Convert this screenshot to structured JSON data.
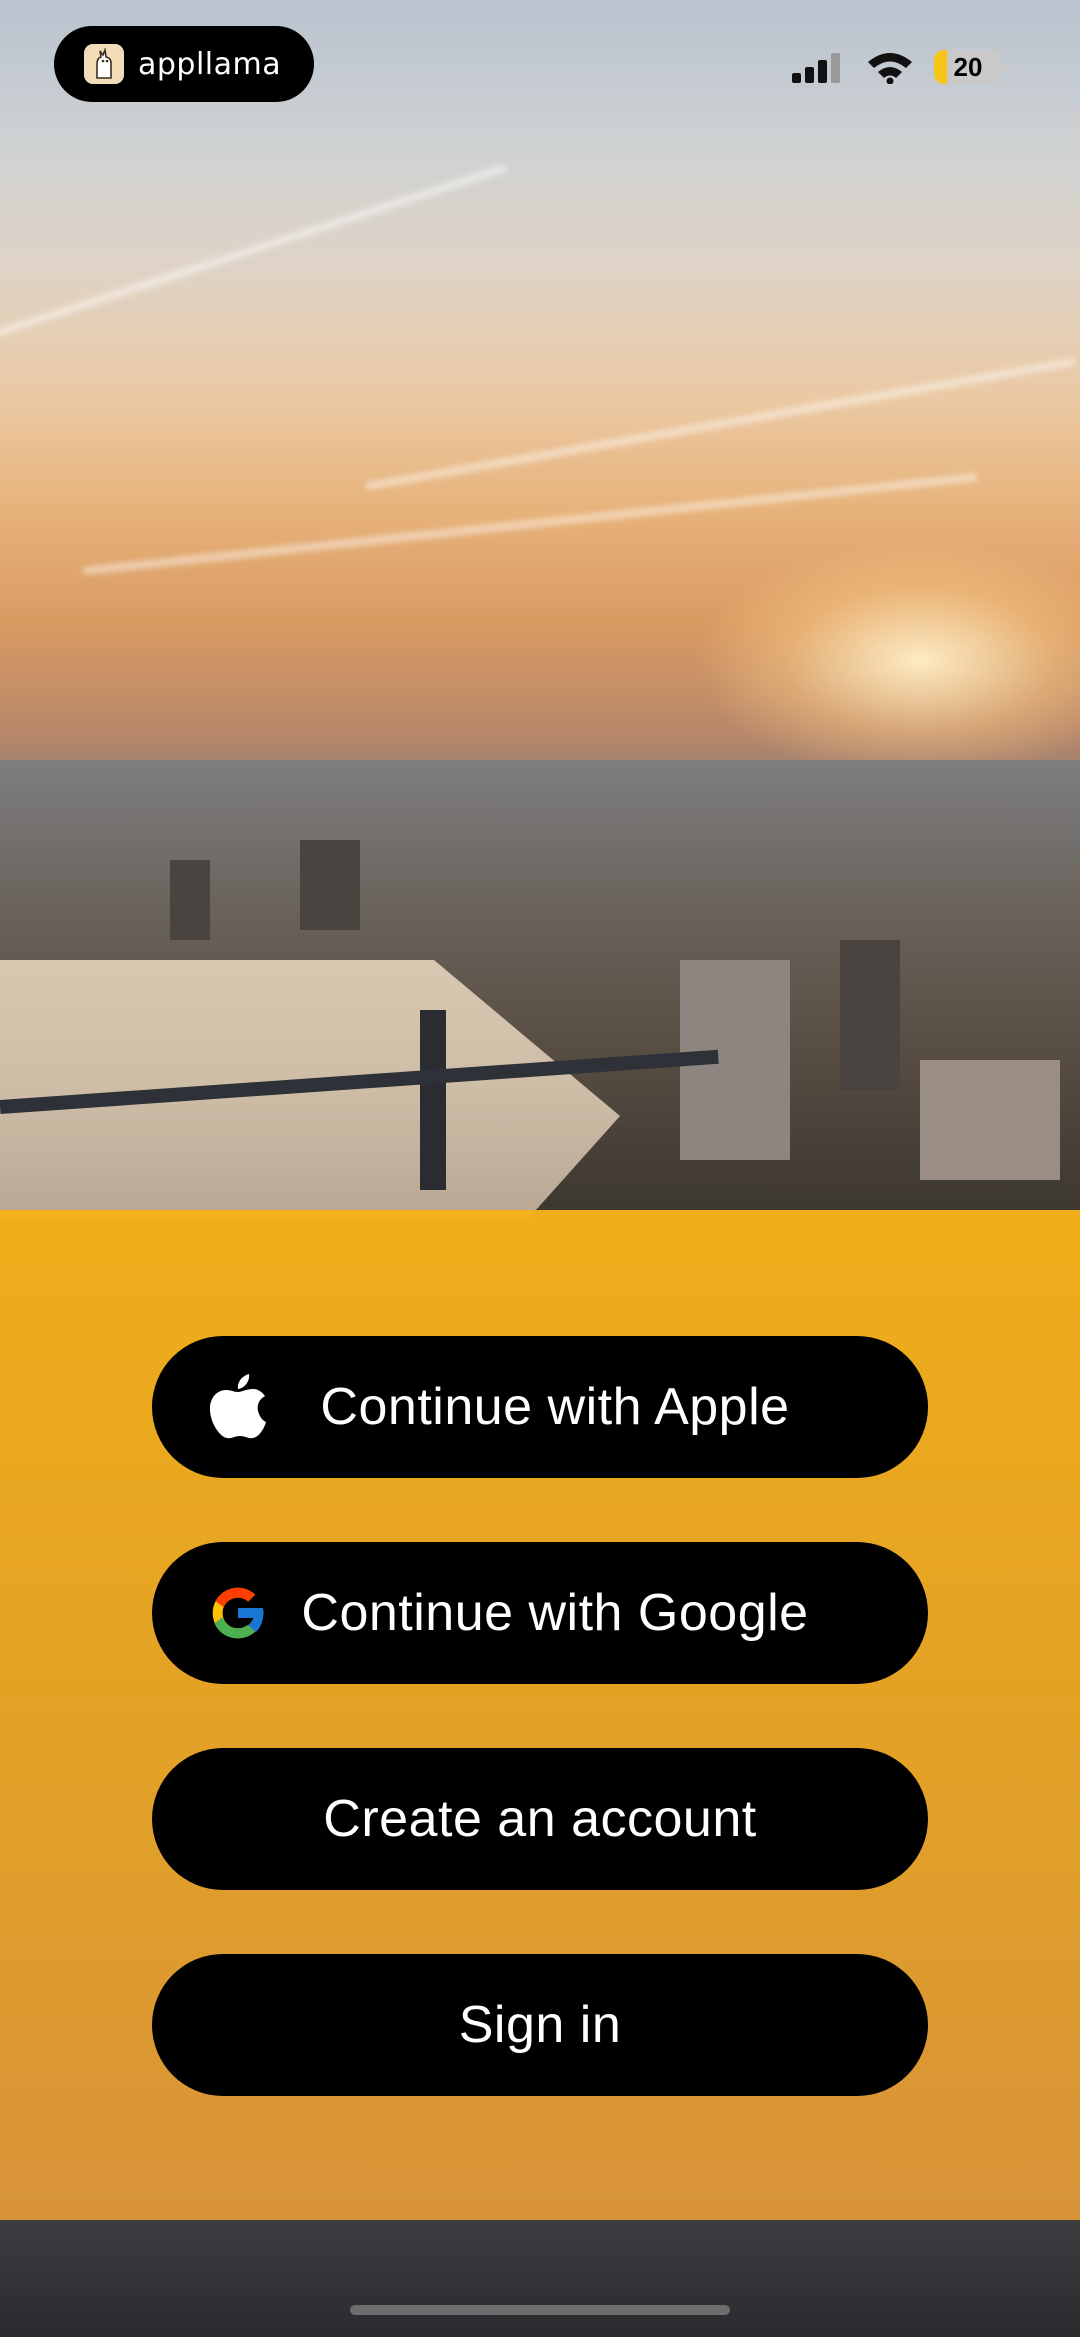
{
  "status_bar": {
    "app_name": "appllama",
    "battery_level": "20",
    "colors": {
      "battery_fill": "#f5c518",
      "pill_bg": "#000000"
    }
  },
  "auth": {
    "apple_label": "Continue with Apple",
    "google_label": "Continue with Google",
    "create_label": "Create an account",
    "signin_label": "Sign in"
  },
  "theme": {
    "panel_color": "#f6b21a",
    "button_bg": "#000000",
    "button_text": "#ffffff"
  },
  "icons": [
    "llama-logo-icon",
    "cellular-signal-icon",
    "wifi-icon",
    "battery-icon",
    "apple-logo-icon",
    "google-logo-icon"
  ]
}
